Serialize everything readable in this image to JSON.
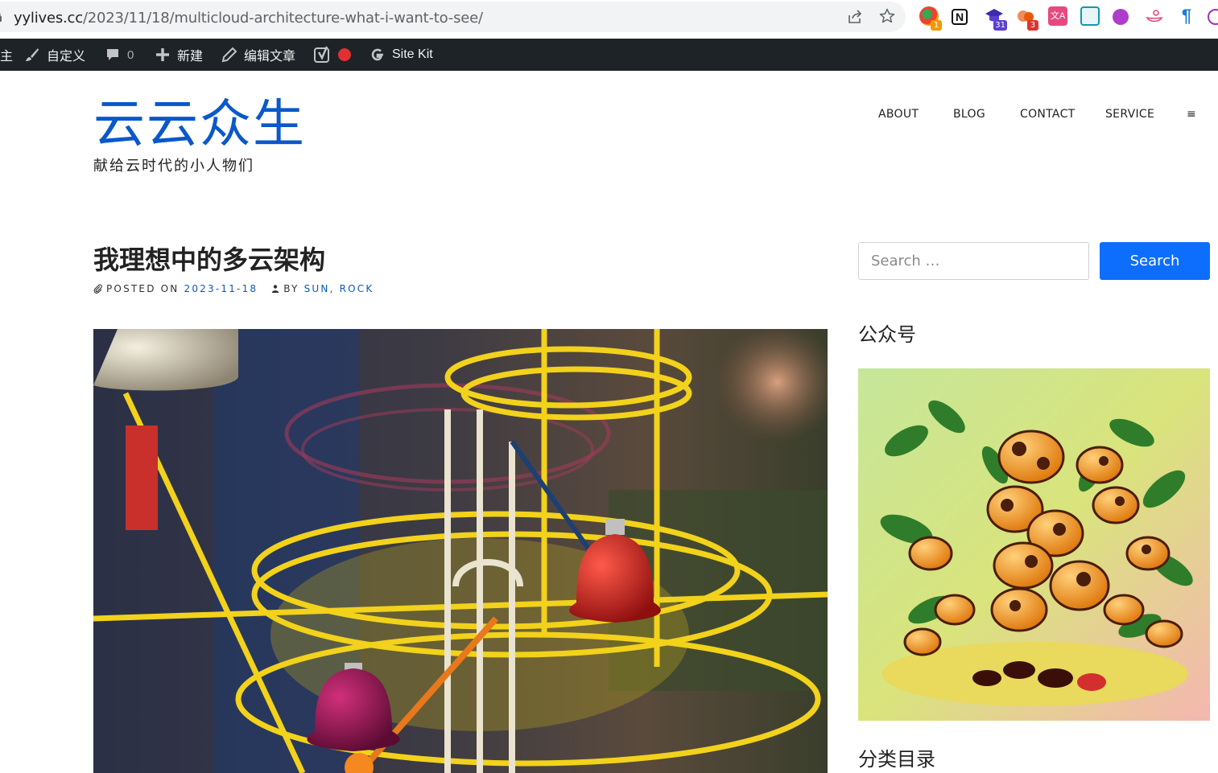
{
  "browser": {
    "url_host": "yylives.cc",
    "url_path": "/2023/11/18/multicloud-architecture-what-i-want-to-see/",
    "extensions": [
      {
        "name": "color-extension-icon",
        "badge": "1",
        "badge_color": "#f29900"
      },
      {
        "name": "notion-icon",
        "badge": ""
      },
      {
        "name": "graduation-extension-icon",
        "badge": "31",
        "badge_color": "#5b3fd1"
      },
      {
        "name": "cloud-extension-icon",
        "badge": "3",
        "badge_color": "#e03131"
      },
      {
        "name": "translate-extension-icon",
        "badge": ""
      },
      {
        "name": "grid-extension-icon",
        "badge": ""
      },
      {
        "name": "purple-extension-icon",
        "badge": ""
      },
      {
        "name": "bird-extension-icon",
        "badge": ""
      },
      {
        "name": "paragraph-extension-icon",
        "badge": ""
      },
      {
        "name": "openai-extension-icon",
        "badge": ""
      }
    ]
  },
  "adminbar": {
    "partial_item": "主",
    "customize": "自定义",
    "comments_count": "0",
    "new": "新建",
    "edit_post": "编辑文章",
    "sitekit": "Site Kit"
  },
  "site": {
    "title": "云云众生",
    "description": "献给云时代的小人物们"
  },
  "nav": {
    "items": [
      "ABOUT",
      "BLOG",
      "CONTACT",
      "SERVICE"
    ],
    "menu_symbol": "≡"
  },
  "post": {
    "title": "我理想中的多云架构",
    "posted_on_label": "POSTED ON",
    "date": "2023-11-18",
    "by_label": "BY",
    "author": "SUN, ROCK"
  },
  "sidebar": {
    "search_placeholder": "Search …",
    "search_button": "Search",
    "widget_wechat_title": "公众号",
    "widget_categories_title": "分类目录"
  },
  "colors": {
    "brand_blue": "#0a58ca",
    "button_blue": "#0d6efd",
    "adminbar_bg": "#1d2327"
  }
}
